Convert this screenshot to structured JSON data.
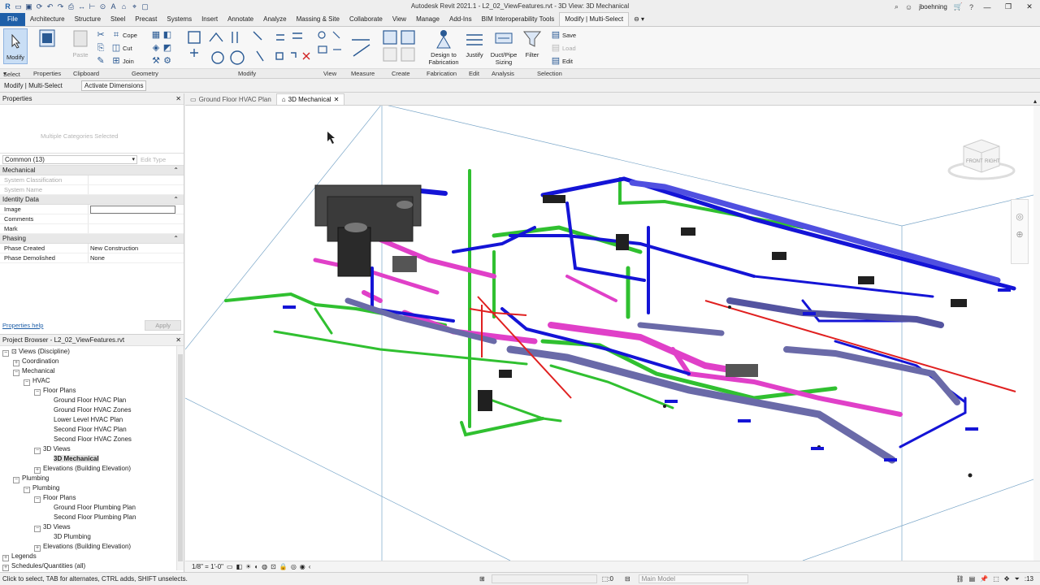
{
  "app": {
    "title": "Autodesk Revit 2021.1 - L2_02_ViewFeatures.rvt - 3D View: 3D Mechanical",
    "user": "jboehning"
  },
  "ribbon_tabs": [
    {
      "label": "File"
    },
    {
      "label": "Architecture"
    },
    {
      "label": "Structure"
    },
    {
      "label": "Steel"
    },
    {
      "label": "Precast"
    },
    {
      "label": "Systems"
    },
    {
      "label": "Insert"
    },
    {
      "label": "Annotate"
    },
    {
      "label": "Analyze"
    },
    {
      "label": "Massing & Site"
    },
    {
      "label": "Collaborate"
    },
    {
      "label": "View"
    },
    {
      "label": "Manage"
    },
    {
      "label": "Add-Ins"
    },
    {
      "label": "BIM Interoperability Tools"
    },
    {
      "label": "Modify | Multi-Select"
    }
  ],
  "ribbon": {
    "modify": "Modify",
    "select": "Select",
    "properties": "Properties",
    "paste": "Paste",
    "cope": "Cope",
    "cut": "Cut",
    "join": "Join",
    "design_fab": "Design to Fabrication",
    "justify": "Justify",
    "duct_pipe_sizing": "Duct/Pipe Sizing",
    "filter": "Filter",
    "save": "Save",
    "load": "Load",
    "edit": "Edit",
    "panels": [
      "Select",
      "Properties",
      "Clipboard",
      "Geometry",
      "Modify",
      "View",
      "Measure",
      "Create",
      "Fabrication",
      "Edit",
      "Analysis",
      "Selection"
    ]
  },
  "options_bar": {
    "context": "Modify | Multi-Select",
    "button": "Activate Dimensions"
  },
  "properties": {
    "title": "Properties",
    "type_selector": "Multiple Categories Selected",
    "filter": "Common (13)",
    "edit_type": "Edit Type",
    "groups": {
      "mechanical": "Mechanical",
      "identity": "Identity Data",
      "phasing": "Phasing"
    },
    "rows": {
      "system_classification": "System Classification",
      "system_name": "System Name",
      "image": "Image",
      "comments": "Comments",
      "mark": "Mark",
      "phase_created": "Phase Created",
      "phase_created_value": "New Construction",
      "phase_demolished": "Phase Demolished",
      "phase_demolished_value": "None"
    },
    "help": "Properties help",
    "apply": "Apply"
  },
  "browser": {
    "title": "Project Browser - L2_02_ViewFeatures.rvt",
    "items": [
      {
        "label": "Views (Discipline)",
        "sym": "−",
        "icon": "views"
      },
      {
        "label": "Coordination",
        "sym": "+"
      },
      {
        "label": "Mechanical",
        "sym": "−"
      },
      {
        "label": "HVAC",
        "sym": "−"
      },
      {
        "label": "Floor Plans",
        "sym": "−"
      },
      {
        "label": "Ground Floor HVAC Plan"
      },
      {
        "label": "Ground Floor HVAC Zones"
      },
      {
        "label": "Lower Level HVAC Plan"
      },
      {
        "label": "Second Floor HVAC Plan"
      },
      {
        "label": "Second Floor HVAC Zones"
      },
      {
        "label": "3D Views",
        "sym": "−"
      },
      {
        "label": "3D Mechanical",
        "selected": true
      },
      {
        "label": "Elevations (Building Elevation)",
        "sym": "+"
      },
      {
        "label": "Plumbing",
        "sym": "−"
      },
      {
        "label": "Plumbing",
        "sym": "−"
      },
      {
        "label": "Floor Plans",
        "sym": "−"
      },
      {
        "label": "Ground Floor Plumbing Plan"
      },
      {
        "label": "Second Floor Plumbing Plan"
      },
      {
        "label": "3D Views",
        "sym": "−"
      },
      {
        "label": "3D Plumbing"
      },
      {
        "label": "Elevations (Building Elevation)",
        "sym": "+"
      },
      {
        "label": "Legends",
        "sym": "+"
      },
      {
        "label": "Schedules/Quantities (all)",
        "sym": "+"
      }
    ]
  },
  "view_tabs": [
    {
      "label": "Ground Floor HVAC Plan"
    },
    {
      "label": "3D Mechanical",
      "active": true
    }
  ],
  "viewcube": {
    "front": "FRONT",
    "right": "RIGHT"
  },
  "view_bar": {
    "scale": "1/8\" = 1'-0\""
  },
  "status": {
    "message": "Click to select, TAB for alternates, CTRL adds, SHIFT unselects.",
    "coords": ":0",
    "model": "Main Model",
    "filter_count": ":13"
  },
  "colors": {
    "supply": "#1414d6",
    "return": "#e040c8",
    "exhaust": "#30c030",
    "pipe_red": "#e02020",
    "duct_gray": "#6a6aa8",
    "accent": "#1f5fa8"
  }
}
